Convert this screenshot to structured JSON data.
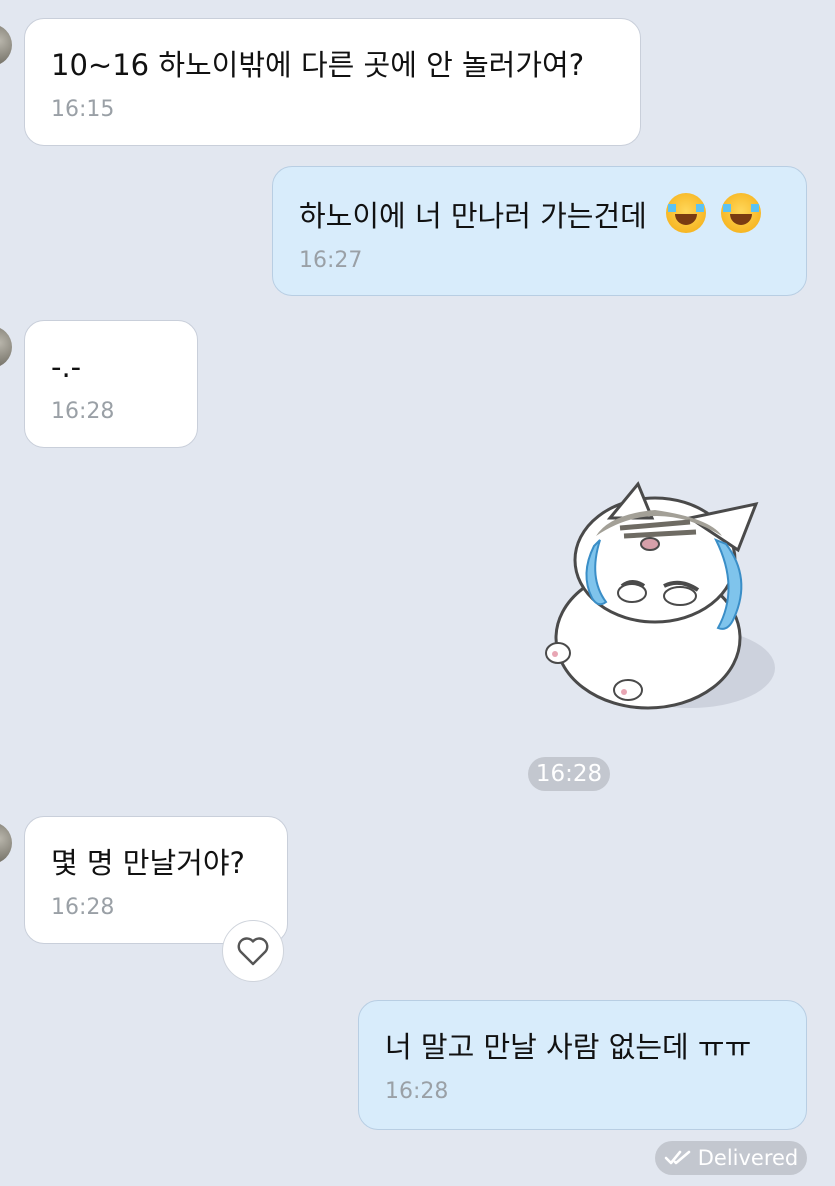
{
  "messages": [
    {
      "direction": "in",
      "text": "10~16 하노이밖에 다른 곳에 안 놀러가여?",
      "time": "16:15"
    },
    {
      "direction": "out",
      "text": "하노이에 너 만나러 가는건데",
      "emoji": [
        "face-with-tears-of-joy",
        "face-with-tears-of-joy"
      ],
      "time": "16:27"
    },
    {
      "direction": "in",
      "text": "-.-",
      "time": "16:28"
    },
    {
      "direction": "in",
      "type": "sticker",
      "sticker": "crying-cat-sticker",
      "time": "16:28"
    },
    {
      "direction": "in",
      "text": "몇 명 만날거야?",
      "time": "16:28",
      "reaction_icon": "heart-outline-icon"
    },
    {
      "direction": "out",
      "text": "너 말고 만날 사람 없는데 ㅠㅠ",
      "time": "16:28"
    }
  ],
  "status": {
    "label": "Delivered",
    "icon": "double-check-icon"
  },
  "colors": {
    "background": "#e2e7f0",
    "incoming_bubble": "#ffffff",
    "outgoing_bubble": "#d8ecfb",
    "timestamp": "#9aa0a6",
    "pill": "#c3c7cf"
  }
}
